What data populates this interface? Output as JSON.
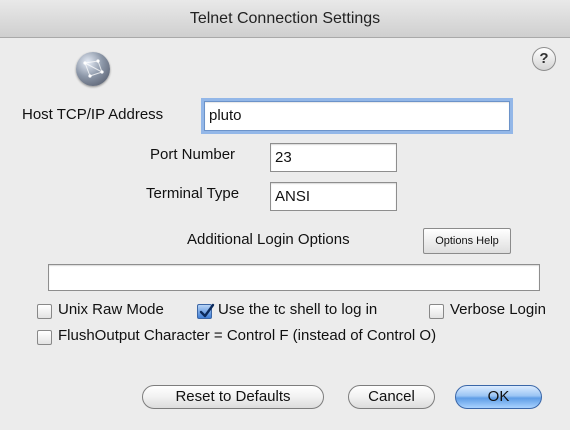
{
  "window": {
    "title": "Telnet Connection Settings"
  },
  "icons": {
    "globe": "globe-network-icon",
    "help": "help-question-icon"
  },
  "help_glyph": "?",
  "host": {
    "label": "Host TCP/IP Address",
    "value": "pluto"
  },
  "port": {
    "label": "Port Number",
    "value": "23"
  },
  "terminal": {
    "label": "Terminal Type",
    "value": "ANSI"
  },
  "login_options": {
    "label": "Additional Login Options",
    "help_button": "Options Help",
    "value": ""
  },
  "checkboxes": {
    "unix_raw": {
      "label": "Unix Raw Mode",
      "checked": false
    },
    "tc_shell": {
      "label": "Use the tc shell to log in",
      "checked": true
    },
    "verbose": {
      "label": "Verbose Login",
      "checked": false
    },
    "flush": {
      "label": "FlushOutput Character = Control F (instead of Control O)",
      "checked": false
    }
  },
  "buttons": {
    "reset": "Reset to Defaults",
    "cancel": "Cancel",
    "ok": "OK"
  },
  "colors": {
    "accent": "#5f9de6",
    "focus_ring": "#93b7e8",
    "background": "#ececec"
  }
}
